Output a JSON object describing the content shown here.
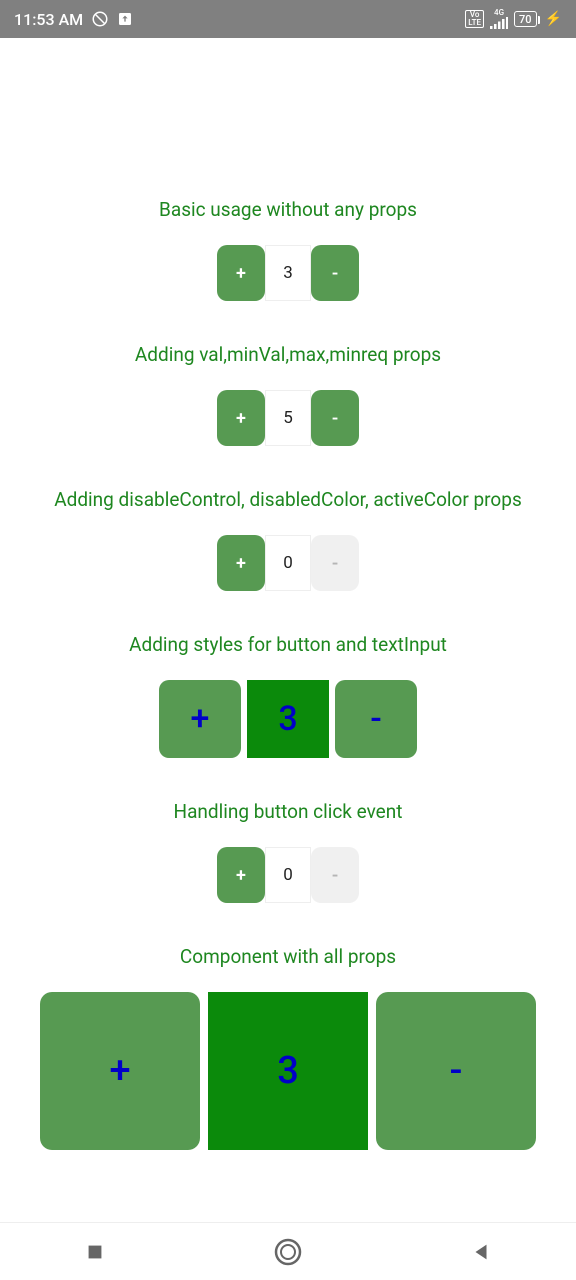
{
  "status": {
    "time": "11:53 AM",
    "battery": "70",
    "network_label": "4G",
    "volte_label": "Vo LTE"
  },
  "sections": {
    "basic": {
      "title": "Basic usage without any props",
      "plus": "+",
      "value": "3",
      "minus": "-"
    },
    "valminmax": {
      "title": "Adding val,minVal,max,minreq props",
      "plus": "+",
      "value": "5",
      "minus": "-"
    },
    "disable": {
      "title": "Adding disableControl, disabledColor, activeColor props",
      "plus": "+",
      "value": "0",
      "minus": "-"
    },
    "styles": {
      "title": "Adding styles for button and textInput",
      "plus": "+",
      "value": "3",
      "minus": "-"
    },
    "events": {
      "title": "Handling button click event",
      "plus": "+",
      "value": "0",
      "minus": "-"
    },
    "allprops": {
      "title": "Component with all props",
      "plus": "+",
      "value": "3",
      "minus": "-"
    }
  }
}
